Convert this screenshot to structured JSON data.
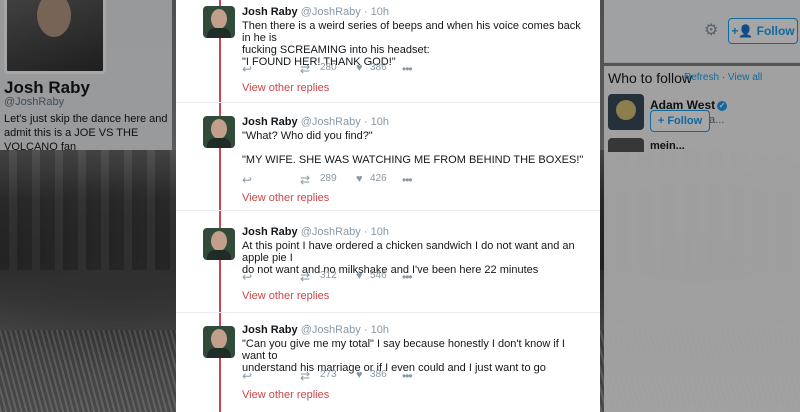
{
  "profile": {
    "name": "Josh Raby",
    "handle": "@JoshRaby",
    "bio": "Let's just skip the dance here and admit this is a JOE VS THE VOLCANO fan"
  },
  "header": {
    "follow_label": "Follow"
  },
  "who_to_follow": {
    "title": "Who to follow",
    "refresh": "Refresh",
    "sep": "·",
    "view_all": "View all",
    "suggestion": {
      "name": "Adam West",
      "handle": "@therealada...",
      "follow_label": "Follow"
    },
    "next_name": "mein..."
  },
  "tweets": [
    {
      "name": "Josh Raby",
      "handle": "@JoshRaby",
      "sep": "·",
      "time": "10h",
      "text": "Then there is a weird series of beeps and when his voice comes back in he is\nfucking SCREAMING into his headset:\n\"I FOUND HER! THANK GOD!\"",
      "retweets": "280",
      "likes": "386",
      "view_replies": "View other replies"
    },
    {
      "name": "Josh Raby",
      "handle": "@JoshRaby",
      "sep": "·",
      "time": "10h",
      "text": "\"What? Who did you find?\"\n\n\"MY WIFE. SHE WAS WATCHING ME FROM BEHIND THE BOXES!\"",
      "retweets": "289",
      "likes": "426",
      "view_replies": "View other replies"
    },
    {
      "name": "Josh Raby",
      "handle": "@JoshRaby",
      "sep": "·",
      "time": "10h",
      "text": "At this point I have ordered a chicken sandwich I do not want and an apple pie I\ndo not want and no milkshake and I've been here 22 minutes",
      "retweets": "312",
      "likes": "546",
      "view_replies": "View other replies"
    },
    {
      "name": "Josh Raby",
      "handle": "@JoshRaby",
      "sep": "·",
      "time": "10h",
      "text": "\"Can you give me my total\" I say because honestly I don't know if I want to\nunderstand his marriage or if I even could and I just want to go",
      "retweets": "273",
      "likes": "386",
      "view_replies": "View other replies"
    }
  ],
  "icons": {
    "reply": "reply-icon",
    "retweet": "retweet-icon",
    "like": "heart-icon",
    "more": "more-icon",
    "gear": "gear-icon"
  },
  "colors": {
    "accent": "#1da1f2",
    "thread": "#c7474c"
  }
}
